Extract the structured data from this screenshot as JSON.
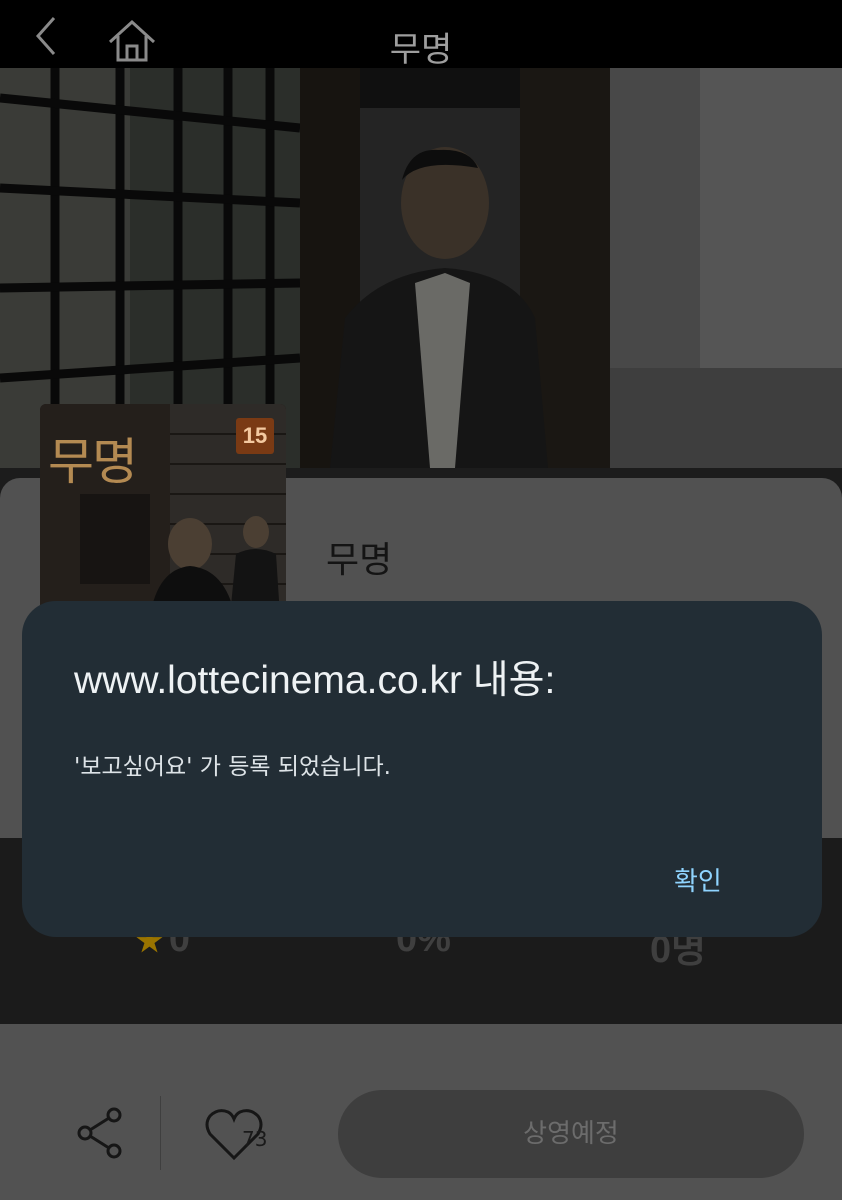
{
  "header": {
    "title": "무명"
  },
  "movie": {
    "title": "무명",
    "subtitle": "",
    "age_rating": "15",
    "poster_caption": "무명"
  },
  "stats": {
    "rating": "0",
    "percent": "0%",
    "viewers": "0명"
  },
  "actions": {
    "like_count": "73",
    "status_label": "상영예정"
  },
  "dialog": {
    "title": "www.lottecinema.co.kr 내용:",
    "message": "'보고싶어요' 가 등록 되었습니다.",
    "confirm_label": "확인"
  },
  "icons": {
    "back": "chevron-left-icon",
    "home": "home-icon",
    "star": "star-icon",
    "share": "share-icon",
    "heart": "heart-icon"
  },
  "colors": {
    "dialog_bg": "#222d35",
    "dialog_button": "#8fd4ff",
    "star": "#9a7400"
  }
}
